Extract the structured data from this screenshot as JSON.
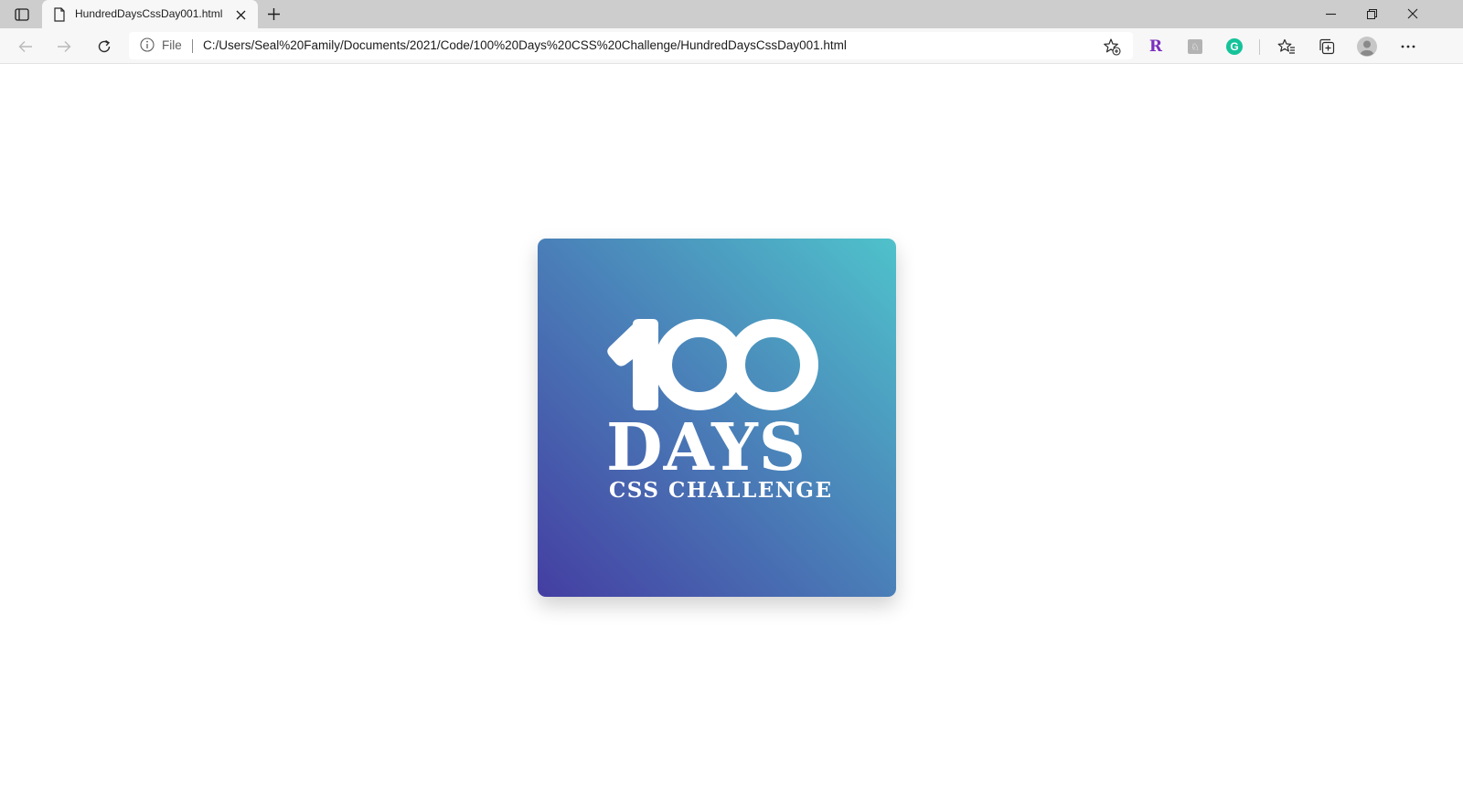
{
  "browser": {
    "tab": {
      "title": "HundredDaysCssDay001.html"
    },
    "omnibox": {
      "site_info_label": "File",
      "url": "C:/Users/Seal%20Family/Documents/2021/Code/100%20Days%20CSS%20Challenge/HundredDaysCssDay001.html"
    },
    "extensions": [
      {
        "name": "extension-r",
        "glyph": "R",
        "color": "#7b2fbe"
      },
      {
        "name": "extension-puzzle",
        "glyph": "♘",
        "color": "#9a9a9a"
      },
      {
        "name": "grammarly-extension",
        "glyph": "G",
        "color": "#15c39a"
      }
    ]
  },
  "page": {
    "logo": {
      "number": "100",
      "days": "DAYS",
      "subtitle": "CSS CHALLENGE"
    },
    "colors": {
      "gradient_start": "#443ea2",
      "gradient_mid": "#4a7fb8",
      "gradient_end": "#4fc2cb"
    }
  }
}
